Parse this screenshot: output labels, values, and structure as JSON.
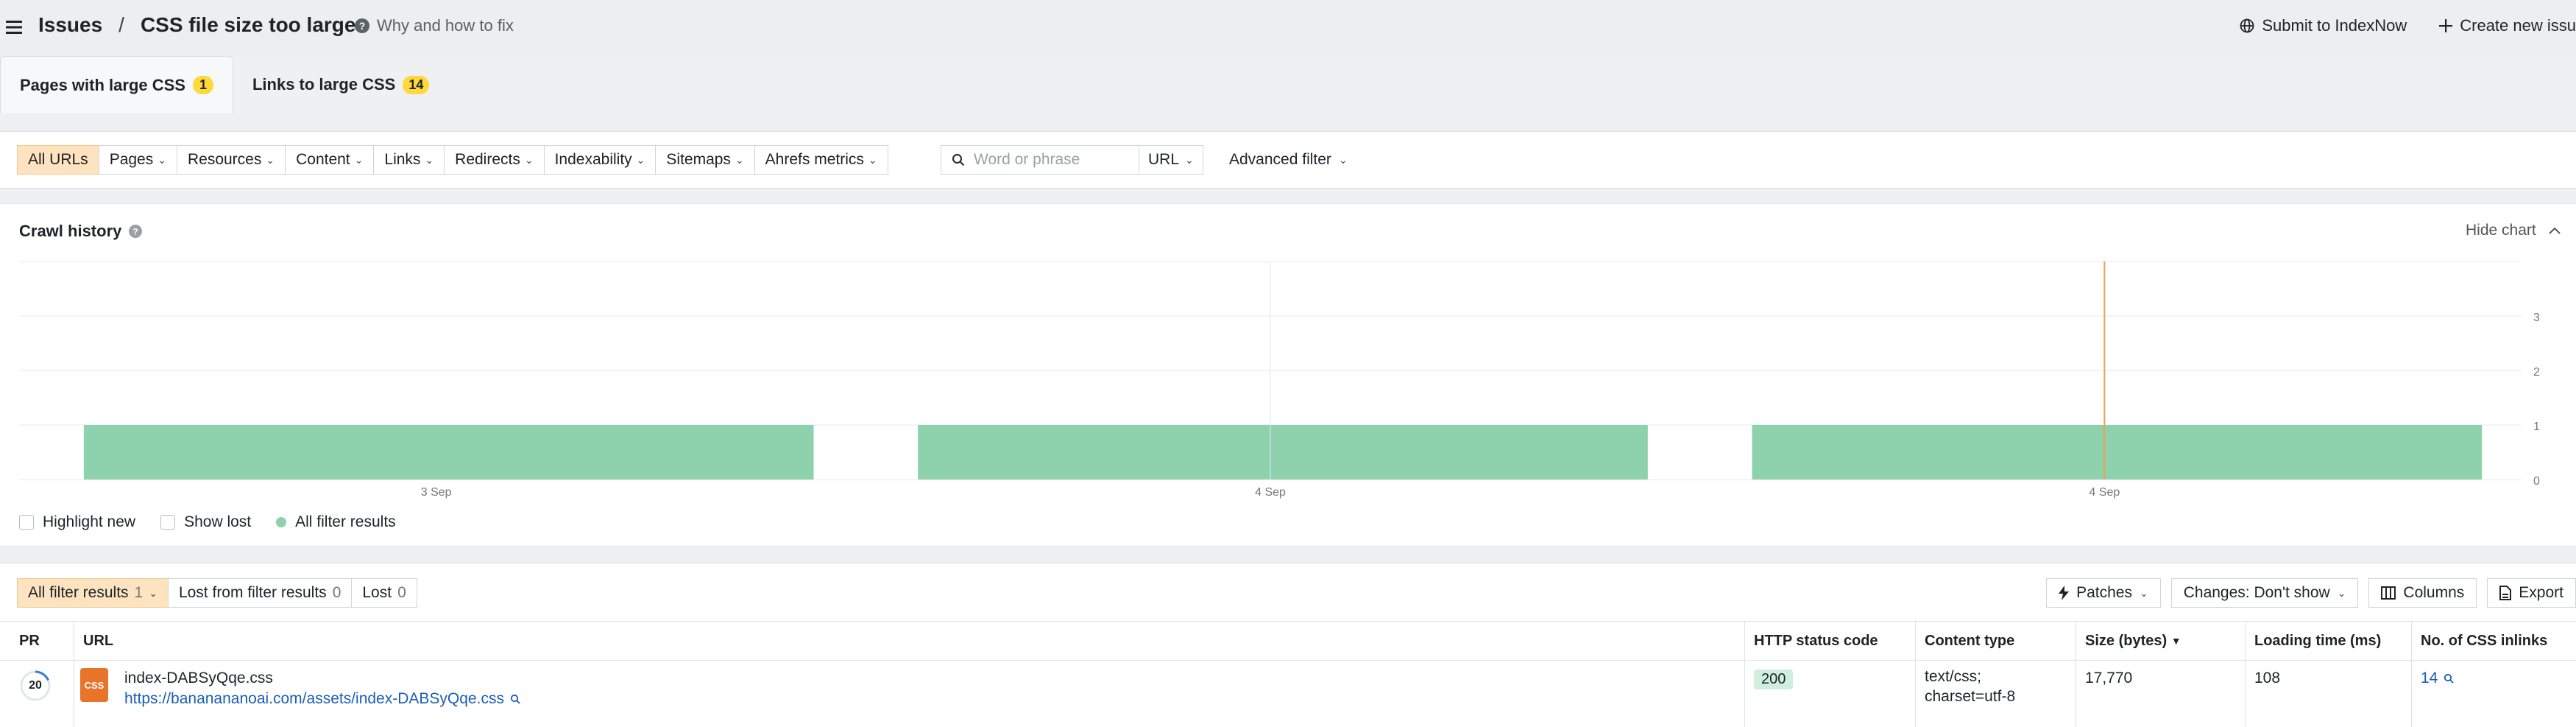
{
  "header": {
    "breadcrumb_root": "Issues",
    "breadcrumb_sep": "/",
    "page_title": "CSS file size too large",
    "help_link": "Why and how to fix",
    "submit_label": "Submit to IndexNow",
    "create_label": "Create new issu"
  },
  "tabs": [
    {
      "label": "Pages with large CSS",
      "count": "1"
    },
    {
      "label": "Links to large CSS",
      "count": "14"
    }
  ],
  "filters": {
    "buttons": [
      "All URLs",
      "Pages",
      "Resources",
      "Content",
      "Links",
      "Redirects",
      "Indexability",
      "Sitemaps",
      "Ahrefs metrics"
    ],
    "search_placeholder": "Word or phrase",
    "url_select": "URL",
    "advanced": "Advanced filter"
  },
  "chart": {
    "title": "Crawl history",
    "hide_label": "Hide chart",
    "legend": {
      "highlight_new": "Highlight new",
      "show_lost": "Show lost",
      "all_results": "All filter results"
    }
  },
  "chart_data": {
    "type": "bar",
    "categories": [
      "3 Sep",
      "4 Sep",
      "4 Sep"
    ],
    "values": [
      1,
      1,
      1
    ],
    "y_ticks": [
      "0",
      "1",
      "2",
      "3"
    ],
    "ylim": [
      0,
      4
    ],
    "grid": true,
    "color": "#8ed1ad",
    "marker_color": "#f0a050"
  },
  "results": {
    "tabs": [
      {
        "label": "All filter results",
        "count": "1"
      },
      {
        "label": "Lost from filter results",
        "count": "0"
      },
      {
        "label": "Lost",
        "count": "0"
      }
    ],
    "tools": {
      "patches": "Patches",
      "changes": "Changes: Don't show",
      "columns": "Columns",
      "export": "Export"
    },
    "columns": {
      "pr": "PR",
      "url": "URL",
      "status": "HTTP status code",
      "ctype": "Content type",
      "size": "Size (bytes)",
      "size_sort": "▼",
      "loading": "Loading time (ms)",
      "inlinks": "No. of CSS inlinks"
    },
    "row": {
      "pr": "20",
      "file_icon": "CSS",
      "file_name": "index-DABSyQqe.css",
      "url": "https://bananananoai.com/assets/index-DABSyQqe.css",
      "status": "200",
      "ctype_line1": "text/css;",
      "ctype_line2": "charset=utf-8",
      "size": "17,770",
      "loading": "108",
      "inlinks": "14"
    }
  }
}
